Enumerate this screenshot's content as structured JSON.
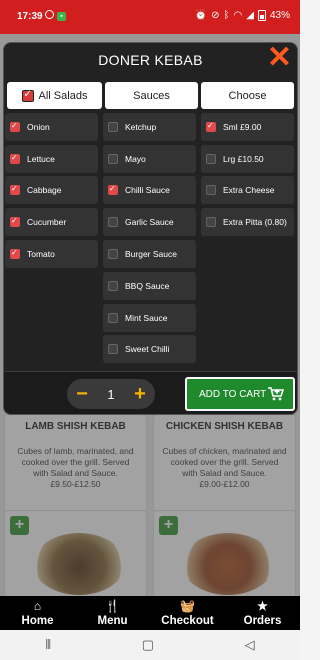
{
  "status_bar": {
    "time": "17:39",
    "battery": "43%"
  },
  "modal": {
    "title": "DONER KEBAB",
    "columns": [
      {
        "header": "All Salads",
        "header_checked": true,
        "options": [
          {
            "label": "Onion",
            "checked": true
          },
          {
            "label": "Lettuce",
            "checked": true
          },
          {
            "label": "Cabbage",
            "checked": true
          },
          {
            "label": "Cucumber",
            "checked": true
          },
          {
            "label": "Tomato",
            "checked": true
          }
        ]
      },
      {
        "header": "Sauces",
        "header_checked": false,
        "options": [
          {
            "label": "Ketchup",
            "checked": false
          },
          {
            "label": "Mayo",
            "checked": false
          },
          {
            "label": "Chilli Sauce",
            "checked": true
          },
          {
            "label": "Garlic Sauce",
            "checked": false
          },
          {
            "label": "Burger Sauce",
            "checked": false
          },
          {
            "label": "BBQ Sauce",
            "checked": false
          },
          {
            "label": "Mint Sauce",
            "checked": false
          },
          {
            "label": "Sweet Chilli",
            "checked": false
          }
        ]
      },
      {
        "header": "Choose",
        "header_checked": false,
        "options": [
          {
            "label": "Sml £9.00",
            "checked": true
          },
          {
            "label": "Lrg £10.50",
            "checked": false
          },
          {
            "label": "Extra Cheese",
            "checked": false
          },
          {
            "label": "Extra Pitta (0.80)",
            "checked": false
          }
        ]
      }
    ],
    "quantity": "1",
    "minus_symbol": "−",
    "plus_symbol": "+",
    "add_to_cart_label": "ADD TO CART"
  },
  "menu_cards": [
    {
      "title": "LAMB SHISH KEBAB",
      "description": "Cubes of lamb, marinated, and cooked over the grill. Served with Salad and Sauce.",
      "price": "£9.50-£12.50"
    },
    {
      "title": "CHICKEN SHISH KEBAB",
      "description": "Cubes of chicken, marinated and cooked over the grill. Served with Salad and Sauce.",
      "price": "£9.00-£12.00"
    }
  ],
  "bottom_nav": [
    {
      "label": "Home",
      "icon": "home-icon"
    },
    {
      "label": "Menu",
      "icon": "cutlery-icon"
    },
    {
      "label": "Checkout",
      "icon": "basket-icon"
    },
    {
      "label": "Orders",
      "icon": "star-icon"
    }
  ],
  "colors": {
    "status_bar": "#d21e1e",
    "modal_bg": "#222222",
    "checkbox_on": "#e04a4a",
    "close": "#ff5a1f",
    "add_cart": "#1f8a2c",
    "stepper_btn": "#f4b400"
  }
}
